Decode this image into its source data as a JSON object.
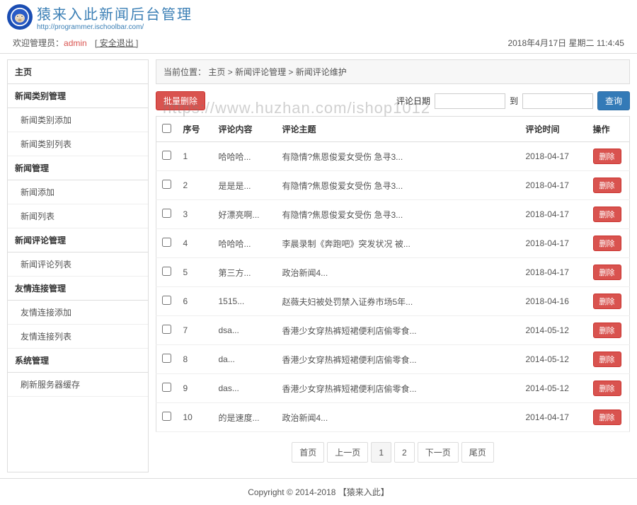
{
  "header": {
    "site_title": "猿来入此新闻后台管理",
    "site_url": "http://programmer.ischoolbar.com/"
  },
  "topbar": {
    "welcome": "欢迎管理员：",
    "admin": "admin",
    "logout": "[ 安全退出 ]",
    "datetime": "2018年4月17日 星期二 11:4:45"
  },
  "sidebar": {
    "groups": [
      {
        "title": "主页",
        "items": []
      },
      {
        "title": "新闻类别管理",
        "items": [
          "新闻类别添加",
          "新闻类别列表"
        ]
      },
      {
        "title": "新闻管理",
        "items": [
          "新闻添加",
          "新闻列表"
        ]
      },
      {
        "title": "新闻评论管理",
        "items": [
          "新闻评论列表"
        ]
      },
      {
        "title": "友情连接管理",
        "items": [
          "友情连接添加",
          "友情连接列表"
        ]
      },
      {
        "title": "系统管理",
        "items": [
          "刷新服务器缓存"
        ]
      }
    ]
  },
  "breadcrumb": {
    "label": "当前位置：",
    "parts": [
      "主页",
      "新闻评论管理",
      "新闻评论维护"
    ],
    "sep": " > "
  },
  "toolbar": {
    "batch_delete": "批量删除",
    "date_label": "评论日期",
    "to": "到",
    "search": "查询"
  },
  "table": {
    "headers": [
      "序号",
      "评论内容",
      "评论主题",
      "评论时间",
      "操作"
    ],
    "delete_label": "删除",
    "rows": [
      {
        "seq": "1",
        "content": "哈哈哈...",
        "topic": "有隐情?焦恩俊爱女受伤 急寻3...",
        "time": "2018-04-17"
      },
      {
        "seq": "2",
        "content": "是是是...",
        "topic": "有隐情?焦恩俊爱女受伤 急寻3...",
        "time": "2018-04-17"
      },
      {
        "seq": "3",
        "content": "好漂亮啊...",
        "topic": "有隐情?焦恩俊爱女受伤 急寻3...",
        "time": "2018-04-17"
      },
      {
        "seq": "4",
        "content": "哈哈哈...",
        "topic": "李晨录制《奔跑吧》突发状况 被...",
        "time": "2018-04-17"
      },
      {
        "seq": "5",
        "content": "第三方...",
        "topic": "政治新闻4...",
        "time": "2018-04-17"
      },
      {
        "seq": "6",
        "content": "1515...",
        "topic": "赵薇夫妇被处罚禁入证券市场5年...",
        "time": "2018-04-16"
      },
      {
        "seq": "7",
        "content": "dsa...",
        "topic": "香港少女穿热裤短裙便利店偷零食...",
        "time": "2014-05-12"
      },
      {
        "seq": "8",
        "content": "da...",
        "topic": "香港少女穿热裤短裙便利店偷零食...",
        "time": "2014-05-12"
      },
      {
        "seq": "9",
        "content": "das...",
        "topic": "香港少女穿热裤短裙便利店偷零食...",
        "time": "2014-05-12"
      },
      {
        "seq": "10",
        "content": "的是速度...",
        "topic": "政治新闻4...",
        "time": "2014-04-17"
      }
    ]
  },
  "pagination": {
    "first": "首页",
    "prev": "上一页",
    "pages": [
      "1",
      "2"
    ],
    "next": "下一页",
    "last": "尾页"
  },
  "footer": {
    "text": "Copyright © 2014-2018 【猿来入此】"
  },
  "watermark": "https://www.huzhan.com/ishop1012"
}
